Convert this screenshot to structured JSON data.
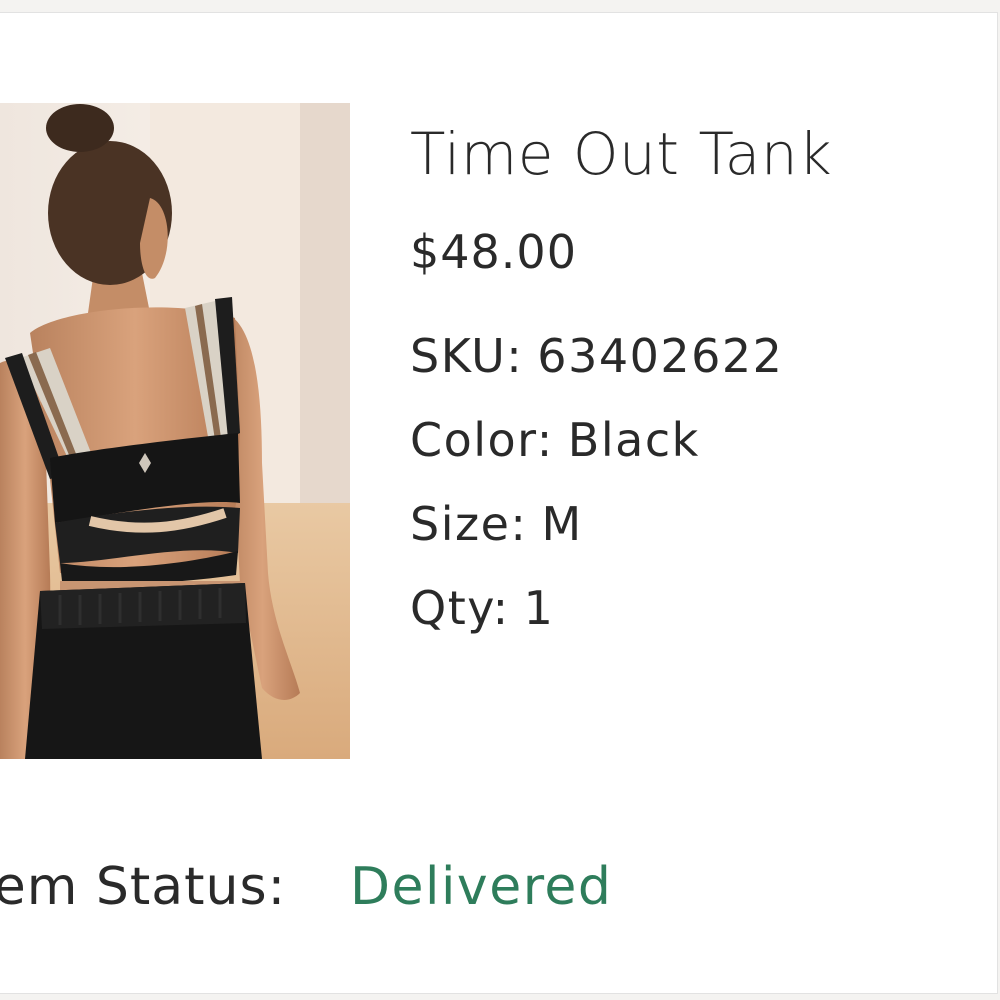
{
  "product": {
    "title": "Time Out Tank",
    "price": "$48.00",
    "sku_label": "SKU:",
    "sku_value": "63402622",
    "color_label": "Color:",
    "color_value": "Black",
    "size_label": "Size:",
    "size_value": "M",
    "qty_label": "Qty:",
    "qty_value": "1",
    "image_icon": "product-photo"
  },
  "status": {
    "label": "Item Status:",
    "value": "Delivered",
    "color": "#2e7d5b"
  }
}
